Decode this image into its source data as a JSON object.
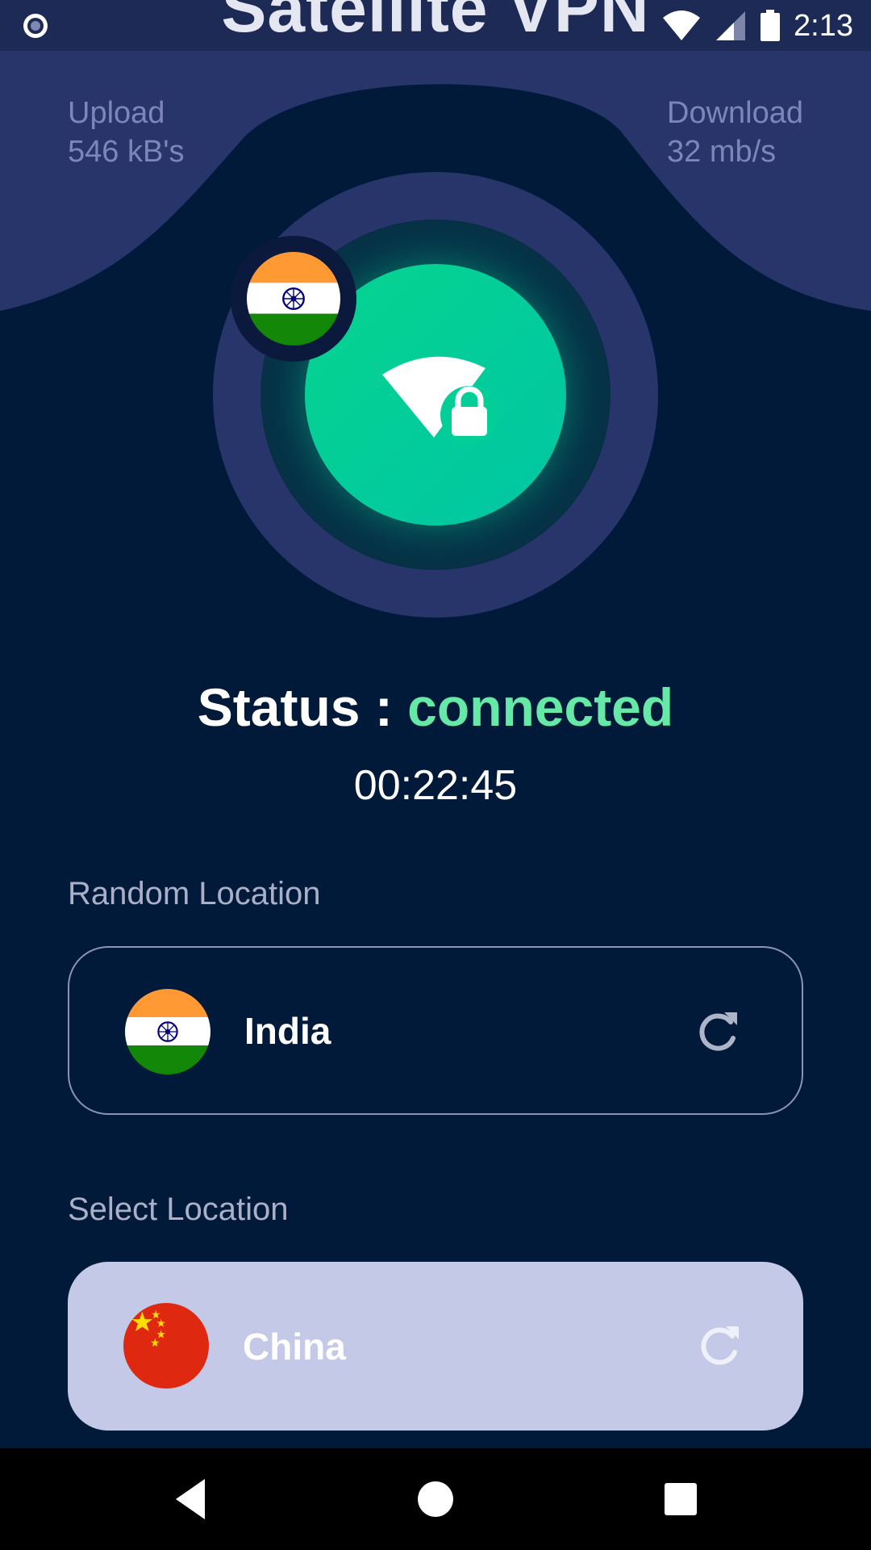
{
  "app": {
    "title": "Satellite VPN"
  },
  "status_bar": {
    "time": "2:13",
    "icons": [
      "recording-icon",
      "wifi-icon",
      "cellular-icon",
      "battery-icon"
    ]
  },
  "stats": {
    "upload": {
      "label": "Upload",
      "value": "546 kB's"
    },
    "download": {
      "label": "Download",
      "value": "32 mb/s"
    }
  },
  "connection": {
    "status_label": "Status : ",
    "status_value": "connected",
    "timer": "00:22:45",
    "current_flag": "india-flag-icon",
    "button_icon": "wifi-lock-icon"
  },
  "random_location": {
    "label": "Random Location",
    "country": "India",
    "flag": "india-flag-icon",
    "action_icon": "refresh-icon"
  },
  "select_location": {
    "label": "Select Location",
    "country": "China",
    "flag": "china-flag-icon",
    "action_icon": "refresh-icon"
  },
  "nav": {
    "items": [
      "back-icon",
      "home-icon",
      "recents-icon"
    ]
  },
  "colors": {
    "background": "#021a3a",
    "accent_green": "#06d48f",
    "status_connected": "#66e8a6",
    "header_band": "#28356a",
    "select_card": "#c5c9e8"
  }
}
